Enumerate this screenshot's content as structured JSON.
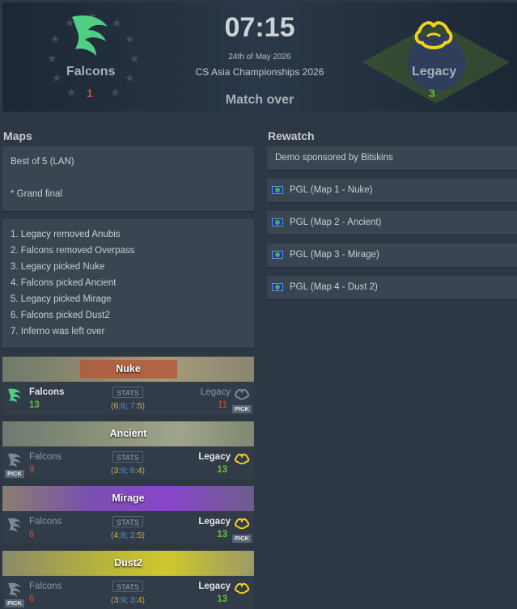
{
  "header": {
    "time": "07:15",
    "date": "24th of May 2026",
    "event": "CS Asia Championships 2026",
    "status": "Match over",
    "team1": {
      "name": "Falcons",
      "score": "1"
    },
    "team2": {
      "name": "Legacy",
      "score": "3"
    },
    "colors": {
      "win": "#5fc03d",
      "lose": "#c5513c",
      "falcons_green": "#4fcf84",
      "legacy_yellow": "#f2d21e"
    }
  },
  "maps_section": {
    "title": "Maps",
    "format": "Best of 5 (LAN)",
    "note": "* Grand final",
    "veto": [
      "1. Legacy removed Anubis",
      "2. Falcons removed Overpass",
      "3. Legacy picked Nuke",
      "4. Falcons picked Ancient",
      "5. Legacy picked Mirage",
      "6. Falcons picked Dust2",
      "7. Inferno was left over"
    ]
  },
  "rewatch_section": {
    "title": "Rewatch",
    "sponsor": "Demo sponsored by Bitskins",
    "streams": [
      {
        "label": "PGL (Map 1 - Nuke)",
        "icon": "flag-icon"
      },
      {
        "label": "PGL (Map 2 - Ancient)",
        "icon": "flag-icon"
      },
      {
        "label": "PGL (Map 3 - Mirage)",
        "icon": "flag-icon"
      },
      {
        "label": "PGL (Map 4 - Dust 2)",
        "icon": "flag-icon"
      }
    ]
  },
  "map_results": [
    {
      "map": "Nuke",
      "team1": "Falcons",
      "team1_score": "13",
      "team2": "Legacy",
      "team2_score": "11",
      "stats_label": "STATS",
      "pick_label": "PICK",
      "pick_by": "team2",
      "winner": "team1",
      "halves": {
        "open": "(",
        "h1a": "6",
        "s1": ":",
        "h1b": "6",
        "sep": "; ",
        "h2a": "7",
        "s2": ":",
        "h2b": "5",
        "close": ")"
      }
    },
    {
      "map": "Ancient",
      "team1": "Falcons",
      "team1_score": "9",
      "team2": "Legacy",
      "team2_score": "13",
      "stats_label": "STATS",
      "pick_label": "PICK",
      "pick_by": "team1",
      "winner": "team2",
      "halves": {
        "open": "(",
        "h1a": "3",
        "s1": ":",
        "h1b": "9",
        "sep": "; ",
        "h2a": "6",
        "s2": ":",
        "h2b": "4",
        "close": ")"
      }
    },
    {
      "map": "Mirage",
      "team1": "Falcons",
      "team1_score": "6",
      "team2": "Legacy",
      "team2_score": "13",
      "stats_label": "STATS",
      "pick_label": "PICK",
      "pick_by": "team2",
      "winner": "team2",
      "halves": {
        "open": "(",
        "h1a": "4",
        "s1": ":",
        "h1b": "8",
        "sep": "; ",
        "h2a": "2",
        "s2": ":",
        "h2b": "5",
        "close": ")"
      }
    },
    {
      "map": "Dust2",
      "team1": "Falcons",
      "team1_score": "6",
      "team2": "Legacy",
      "team2_score": "13",
      "stats_label": "STATS",
      "pick_label": "PICK",
      "pick_by": "team1",
      "winner": "team2",
      "halves": {
        "open": "(",
        "h1a": "3",
        "s1": ":",
        "h1b": "9",
        "sep": "; ",
        "h2a": "3",
        "s2": ":",
        "h2b": "4",
        "close": ")"
      }
    }
  ]
}
